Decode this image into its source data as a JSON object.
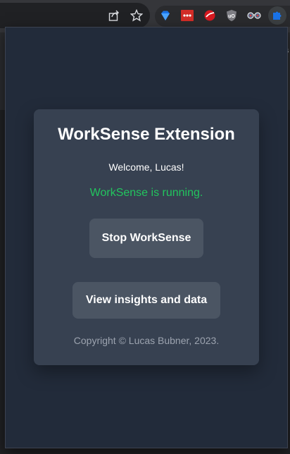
{
  "browser_toolbar": {
    "icons": [
      "share-icon",
      "star-icon",
      "diamond-extension-icon",
      "lastpass-extension-icon",
      "trend-micro-extension-icon",
      "ublock-origin-extension-icon",
      "glasses-extension-icon",
      "puzzle-extension-icon"
    ],
    "lastpass_label": "•••",
    "ublock_label": "uO"
  },
  "popup": {
    "title": "WorkSense Extension",
    "welcome": "Welcome, Lucas!",
    "status": "WorkSense is running.",
    "stop_button": "Stop WorkSense",
    "insights_button": "View insights and data",
    "copyright": "Copyright © Lucas Bubner, 2023."
  },
  "colors": {
    "popup_bg": "#222b3a",
    "card_bg": "#374151",
    "button_bg": "#4b5563",
    "status_green": "#22c55e",
    "copyright_gray": "#9ca3af"
  }
}
